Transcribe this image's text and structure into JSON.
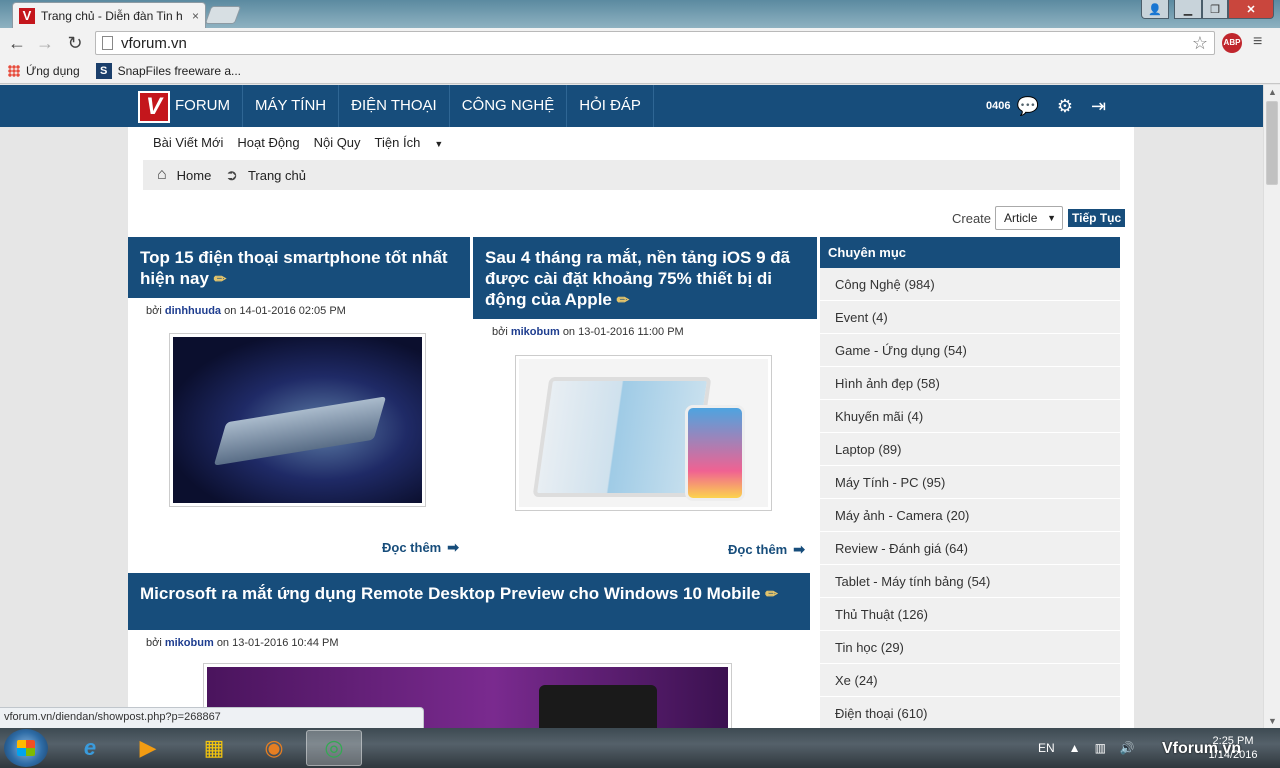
{
  "browser": {
    "tab_title": "Trang chủ - Diễn đàn Tin h",
    "tab_close": "×",
    "url": "vforum.vn",
    "bookmarks": [
      "Ứng dụng",
      "SnapFiles freeware a..."
    ],
    "abp_label": "ABP"
  },
  "nav": {
    "links": [
      "FORUM",
      "MÁY TÍNH",
      "ĐIỆN THOẠI",
      "CÔNG NGHỆ",
      "HỎI ĐÁP"
    ],
    "user_id": "0406"
  },
  "subnav": [
    "Bài Viết Mới",
    "Hoạt Động",
    "Nội Quy",
    "Tiện Ích"
  ],
  "breadcrumb": {
    "home": "Home",
    "current": "Trang chủ"
  },
  "create": {
    "label": "Create",
    "selected": "Article",
    "button": "Tiếp Tục"
  },
  "articles": [
    {
      "title": "Top 15 điện thoại smartphone tốt nhất hiện nay",
      "by": "bởi",
      "author": "dinhhuuda",
      "date": "on 14-01-2016 02:05 PM",
      "read_more": "Đọc thêm"
    },
    {
      "title": "Sau 4 tháng ra mắt, nền tảng iOS 9 đã được cài đặt khoảng 75% thiết bị di động của Apple",
      "by": "bởi",
      "author": "mikobum",
      "date": "on 13-01-2016 11:00 PM",
      "read_more": "Đọc thêm"
    },
    {
      "title": "Microsoft ra mắt ứng dụng Remote Desktop Preview cho Windows 10 Mobile",
      "by": "bởi",
      "author": "mikobum",
      "date": "on 13-01-2016 10:44 PM"
    }
  ],
  "sidebar": {
    "title": "Chuyên mục",
    "categories": [
      "Công Nghệ (984)",
      "Event (4)",
      "Game - Ứng dụng (54)",
      "Hình ảnh đẹp (58)",
      "Khuyến mãi (4)",
      "Laptop (89)",
      "Máy Tính - PC (95)",
      "Máy ảnh - Camera (20)",
      "Review - Đánh giá (64)",
      "Tablet - Máy tính bảng (54)",
      "Thủ Thuật (126)",
      "Tin học (29)",
      "Xe (24)",
      "Điện thoại (610)"
    ]
  },
  "status_url": "vforum.vn/diendan/showpost.php?p=268867",
  "taskbar": {
    "lang": "EN",
    "time": "2:25 PM",
    "date": "1/14/2016",
    "watermark": "Vforum.vn"
  },
  "colors": {
    "nav_bg": "#174d7b",
    "brand_red": "#c4161c",
    "author_link": "#1e3d8f"
  }
}
